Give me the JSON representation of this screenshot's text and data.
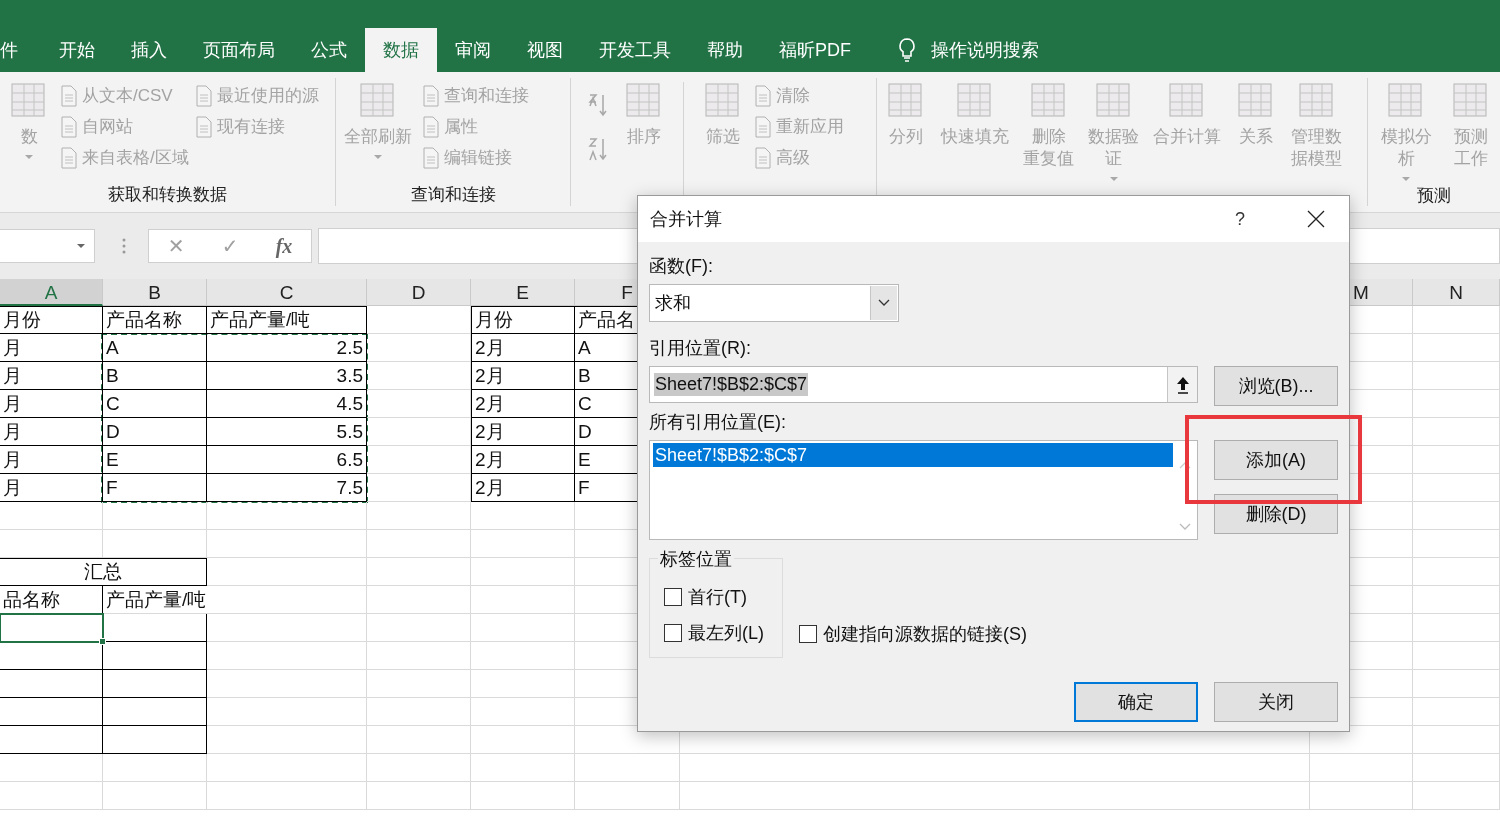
{
  "ribbon_tabs": [
    {
      "label": "件",
      "selected": false
    },
    {
      "label": "开始",
      "selected": false
    },
    {
      "label": "插入",
      "selected": false
    },
    {
      "label": "页面布局",
      "selected": false
    },
    {
      "label": "公式",
      "selected": false
    },
    {
      "label": "数据",
      "selected": true
    },
    {
      "label": "审阅",
      "selected": false
    },
    {
      "label": "视图",
      "selected": false
    },
    {
      "label": "开发工具",
      "selected": false
    },
    {
      "label": "帮助",
      "selected": false
    },
    {
      "label": "福昕PDF",
      "selected": false
    }
  ],
  "tell_me": {
    "label": "操作说明搜索"
  },
  "ribbon_groups": [
    {
      "label": "获取和转换数据",
      "columns": [
        {
          "kind": "large",
          "lines": [
            "数"
          ],
          "dropdown": true
        },
        {
          "kind": "small",
          "items": [
            "从文本/CSV",
            "自网站",
            "来自表格/区域"
          ]
        },
        {
          "kind": "small",
          "items": [
            "最近使用的源",
            "现有连接"
          ]
        }
      ]
    },
    {
      "label": "查询和连接",
      "columns": [
        {
          "kind": "large",
          "lines": [
            "全部刷新"
          ],
          "dropdown": true
        },
        {
          "kind": "small",
          "items": [
            "查询和连接",
            "属性",
            "编辑链接"
          ]
        }
      ]
    },
    {
      "columns": [
        {
          "kind": "sort"
        },
        {
          "kind": "large",
          "lines": [
            "排序"
          ],
          "dropdown": false
        },
        {
          "kind": "separator"
        },
        {
          "kind": "large",
          "lines": [
            "筛选"
          ],
          "dropdown": false
        },
        {
          "kind": "small",
          "items": [
            "清除",
            "重新应用",
            "高级"
          ]
        }
      ]
    },
    {
      "columns": [
        {
          "kind": "large",
          "lines": [
            "分列"
          ],
          "dropdown": false
        },
        {
          "kind": "large",
          "lines": [
            "快速填充"
          ],
          "dropdown": false
        },
        {
          "kind": "large",
          "lines": [
            "删除",
            "重复值"
          ],
          "dropdown": false
        },
        {
          "kind": "large",
          "lines": [
            "数据验",
            "证"
          ],
          "dropdown": true
        },
        {
          "kind": "large",
          "lines": [
            "合并计算"
          ],
          "dropdown": false
        },
        {
          "kind": "large",
          "lines": [
            "关系"
          ],
          "dropdown": false
        },
        {
          "kind": "large",
          "lines": [
            "管理数",
            "据模型"
          ],
          "dropdown": false
        }
      ]
    },
    {
      "label": "预测",
      "columns": [
        {
          "kind": "large",
          "lines": [
            "模拟分析"
          ],
          "dropdown": true
        },
        {
          "kind": "large",
          "lines": [
            "预测",
            "工作"
          ],
          "dropdown": false
        }
      ]
    }
  ],
  "formula_bar": {
    "cancel": "✕",
    "enter": "✓",
    "function": "fx"
  },
  "columns": [
    {
      "label": "A",
      "selected": true
    },
    {
      "label": "B",
      "selected": false
    },
    {
      "label": "C",
      "selected": false
    },
    {
      "label": "D",
      "selected": false
    },
    {
      "label": "E",
      "selected": false
    },
    {
      "label": "F",
      "selected": false
    },
    {
      "label": "M",
      "selected": false
    },
    {
      "label": "N",
      "selected": false
    }
  ],
  "source_table_1": {
    "copy_marquee": true,
    "headers": [
      "月份",
      "产品名称",
      "产品产量/吨"
    ],
    "rows": [
      [
        "月",
        "A",
        "2.5"
      ],
      [
        "月",
        "B",
        "3.5"
      ],
      [
        "月",
        "C",
        "4.5"
      ],
      [
        "月",
        "D",
        "5.5"
      ],
      [
        "月",
        "E",
        "6.5"
      ],
      [
        "月",
        "F",
        "7.5"
      ]
    ]
  },
  "source_table_2": {
    "headers": [
      "月份",
      "产品名"
    ],
    "rows": [
      [
        "2月",
        "A"
      ],
      [
        "2月",
        "B"
      ],
      [
        "2月",
        "C"
      ],
      [
        "2月",
        "D"
      ],
      [
        "2月",
        "E"
      ],
      [
        "2月",
        "F"
      ]
    ]
  },
  "summary_table": {
    "title": "汇总",
    "headers": [
      "品名称",
      "产品产量/吨"
    ],
    "first_cell_active": true
  },
  "dialog": {
    "title": "合并计算",
    "help": "?",
    "function_label": "函数(F):",
    "function_value": "求和",
    "reference_label": "引用位置(R):",
    "reference_value": "Sheet7!$B$2:$C$7",
    "reference_value_selected": true,
    "browse_button": "浏览(B)...",
    "all_references_label": "所有引用位置(E):",
    "all_references": [
      {
        "label": "Sheet7!$B$2:$C$7",
        "selected": true
      }
    ],
    "list_buttons": [
      "添加(A)",
      "删除(D)"
    ],
    "label_group": "标签位置",
    "options": [
      {
        "label": "首行(T)",
        "checked": false
      },
      {
        "label": "最左列(L)",
        "checked": false
      },
      {
        "label": "创建指向源数据的链接(S)",
        "checked": false
      }
    ],
    "footer_buttons": [
      {
        "label": "确定",
        "default": true
      },
      {
        "label": "关闭",
        "default": false
      }
    ]
  },
  "annotation": {
    "kind": "frame"
  }
}
